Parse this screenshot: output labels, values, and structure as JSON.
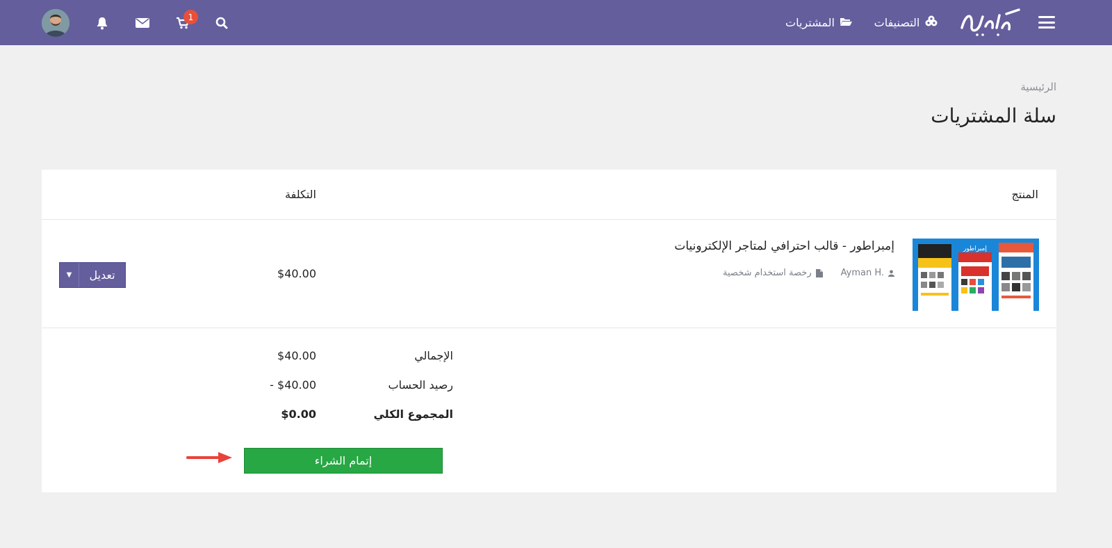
{
  "header": {
    "nav": {
      "categories": "التصنيفات",
      "purchases": "المشتريات"
    },
    "cart_count": "1",
    "colors": {
      "bar": "#645e9d",
      "badge": "#e8503a"
    },
    "icons": [
      "menu-icon",
      "logo",
      "categories-icon",
      "folder-open-icon",
      "search-icon",
      "cart-icon",
      "mail-icon",
      "bell-icon",
      "avatar"
    ]
  },
  "breadcrumb": "الرئيسية",
  "page_title": "سلة المشتريات",
  "table": {
    "headers": {
      "product": "المنتج",
      "cost": "التكلفة"
    },
    "item": {
      "title": "إمبراطور - قالب احترافي لمتاجر الإلكترونيات",
      "author": "Ayman H.",
      "license": "رخصة استخدام شخصية",
      "price": "$40.00",
      "thumb_text": "إمبراطور",
      "edit_label": "تعديل"
    }
  },
  "summary": {
    "subtotal_label": "الإجمالي",
    "subtotal_value": "$40.00",
    "balance_label": "رصيد الحساب",
    "balance_value": "- $40.00",
    "total_label": "المجموع الكلي",
    "total_value": "$0.00"
  },
  "checkout_label": "إتمام الشراء",
  "colors": {
    "checkout": "#28a745",
    "arrow": "#e8423a"
  }
}
